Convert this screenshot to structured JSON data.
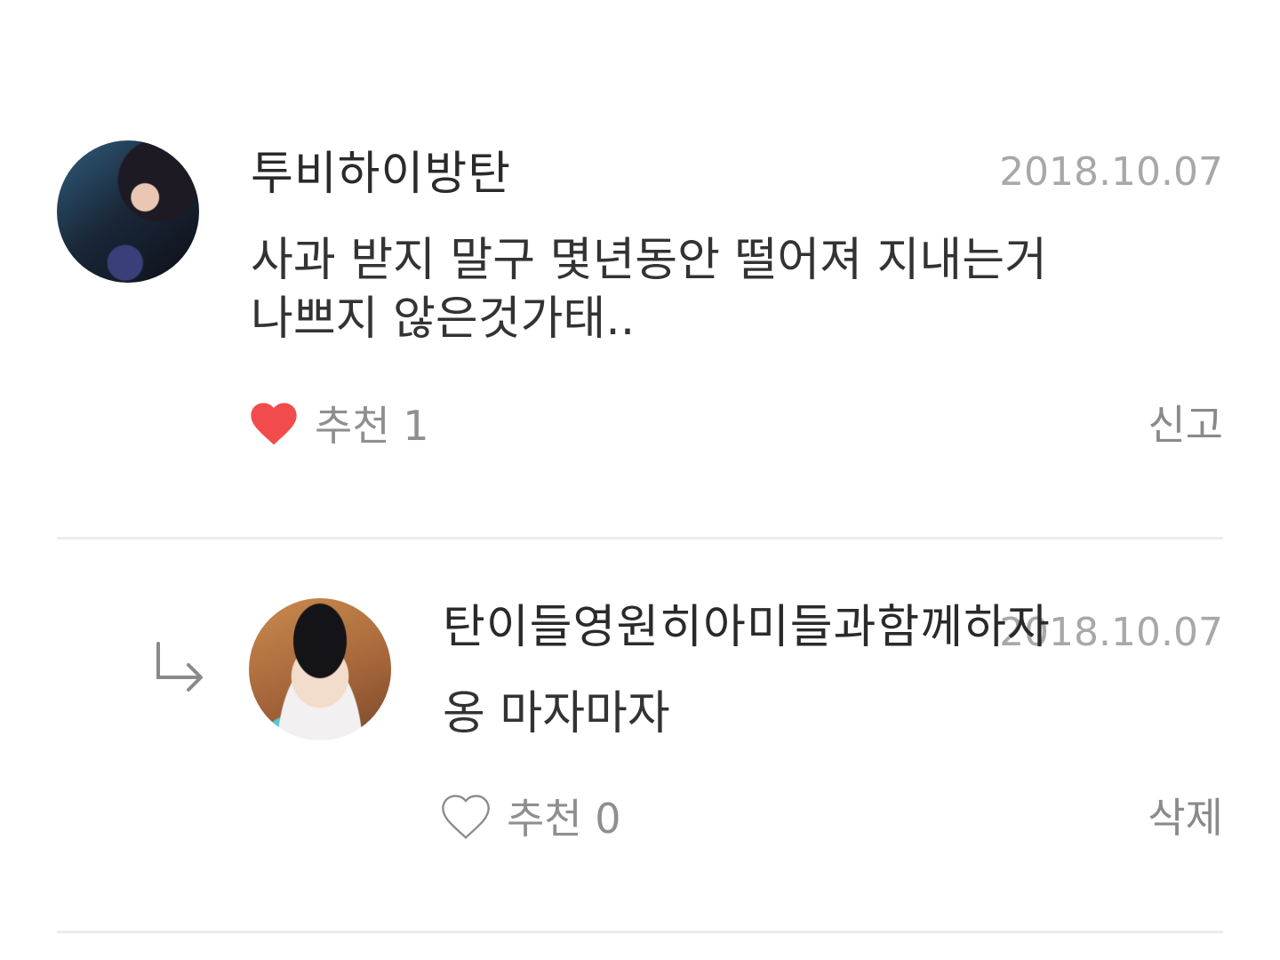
{
  "comments": [
    {
      "username": "투비하이방탄",
      "date": "2018.10.07",
      "text_lines": [
        "사과 받지 말구 몇년동안 떨어져 지내는거",
        "나쁘지 않은것가태.."
      ],
      "like_label": "추천 1",
      "liked": true,
      "action_label": "신고"
    },
    {
      "username": "탄이들영원히아미들과함께하자",
      "date": "2018.10.07",
      "text_lines": [
        "옹 마자마자"
      ],
      "like_label": "추천 0",
      "liked": false,
      "action_label": "삭제",
      "is_reply": true
    }
  ],
  "colors": {
    "heart_filled": "#f24b4b",
    "heart_outline": "#8a8a8a",
    "date": "#a8a8a8",
    "divider": "#ececec"
  },
  "icons": {
    "reply": "reply-arrow-icon",
    "like_filled": "heart-filled-icon",
    "like_outline": "heart-outline-icon"
  }
}
